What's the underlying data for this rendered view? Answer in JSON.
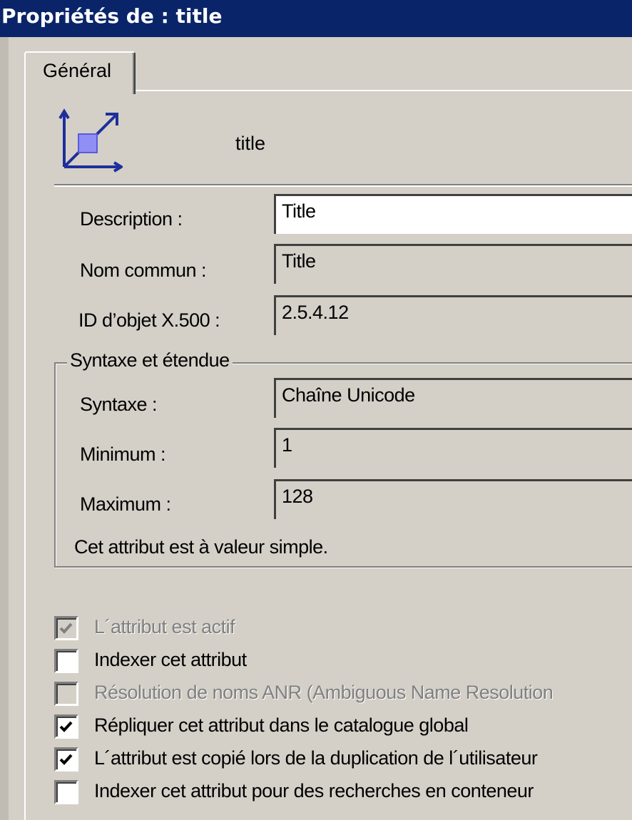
{
  "window": {
    "title": "Propriétés de : title"
  },
  "tabs": [
    {
      "label": "Général"
    }
  ],
  "header": {
    "icon": "attribute-icon",
    "attribute_name": "title"
  },
  "fields": [
    {
      "label": "Description :",
      "value": "Title",
      "editable": true
    },
    {
      "label": "Nom commun :",
      "value": "Title",
      "editable": false
    },
    {
      "label": "ID d’objet X.500 :",
      "value": "2.5.4.12",
      "editable": false
    }
  ],
  "syntax_group": {
    "legend": "Syntaxe et étendue",
    "fields": [
      {
        "label": "Syntaxe :",
        "value": "Chaîne Unicode"
      },
      {
        "label": "Minimum :",
        "value": "1"
      },
      {
        "label": "Maximum :",
        "value": "128"
      }
    ],
    "note": "Cet attribut est à valeur simple."
  },
  "options": [
    {
      "label": "L´attribut est actif",
      "checked": true,
      "enabled": false
    },
    {
      "label": "Indexer cet attribut",
      "checked": false,
      "enabled": true
    },
    {
      "label": "Résolution de noms ANR (Ambiguous Name Resolution",
      "checked": false,
      "enabled": false
    },
    {
      "label": "Répliquer cet attribut dans le catalogue global",
      "checked": true,
      "enabled": true
    },
    {
      "label": "L´attribut est copié lors de la duplication de l´utilisateur",
      "checked": true,
      "enabled": true
    },
    {
      "label": "Indexer cet attribut pour des recherches en conteneur",
      "checked": false,
      "enabled": true
    }
  ]
}
